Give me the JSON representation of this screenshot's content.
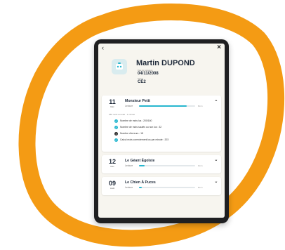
{
  "colors": {
    "accent_orange": "#f49b14",
    "progress_teal": "#27b7cf",
    "ok_teal": "#27b7cf",
    "error_dark": "#2c2c2c"
  },
  "header": {
    "back_icon": "chevron-left-icon",
    "close_icon": "close-icon"
  },
  "student": {
    "name": "Martin DUPOND",
    "birth_label": "Date de naissance",
    "birth_date": "04/11/2008",
    "level_label": "Niveau",
    "level": "CE2"
  },
  "sessions": [
    {
      "day": "11",
      "month": "Déc",
      "title": "Monsieur Petit",
      "category": "Lecture",
      "duration": "8min",
      "progress": 0.85,
      "expanded": true,
      "meta": "250 mots au total · 1 minute",
      "stats": [
        {
          "status": "ok",
          "text": "Nombre de mots lus : 200/160"
        },
        {
          "status": "ok",
          "text": "Nombre de mots sautés ou non lus : 32"
        },
        {
          "status": "error",
          "text": "Nombre d'erreurs : 18"
        },
        {
          "status": "ok",
          "text": "Calcul mots correctement lus par minute : 203"
        }
      ]
    },
    {
      "day": "12",
      "month": "Nov",
      "title": "Le Géant Égoïste",
      "category": "Lecture",
      "duration": "9min",
      "progress": 0.1,
      "expanded": false
    },
    {
      "day": "09",
      "month": "Août",
      "title": "Le Chien À Puces",
      "category": "Lecture",
      "duration": "8min",
      "progress": 0.05,
      "expanded": false
    }
  ]
}
